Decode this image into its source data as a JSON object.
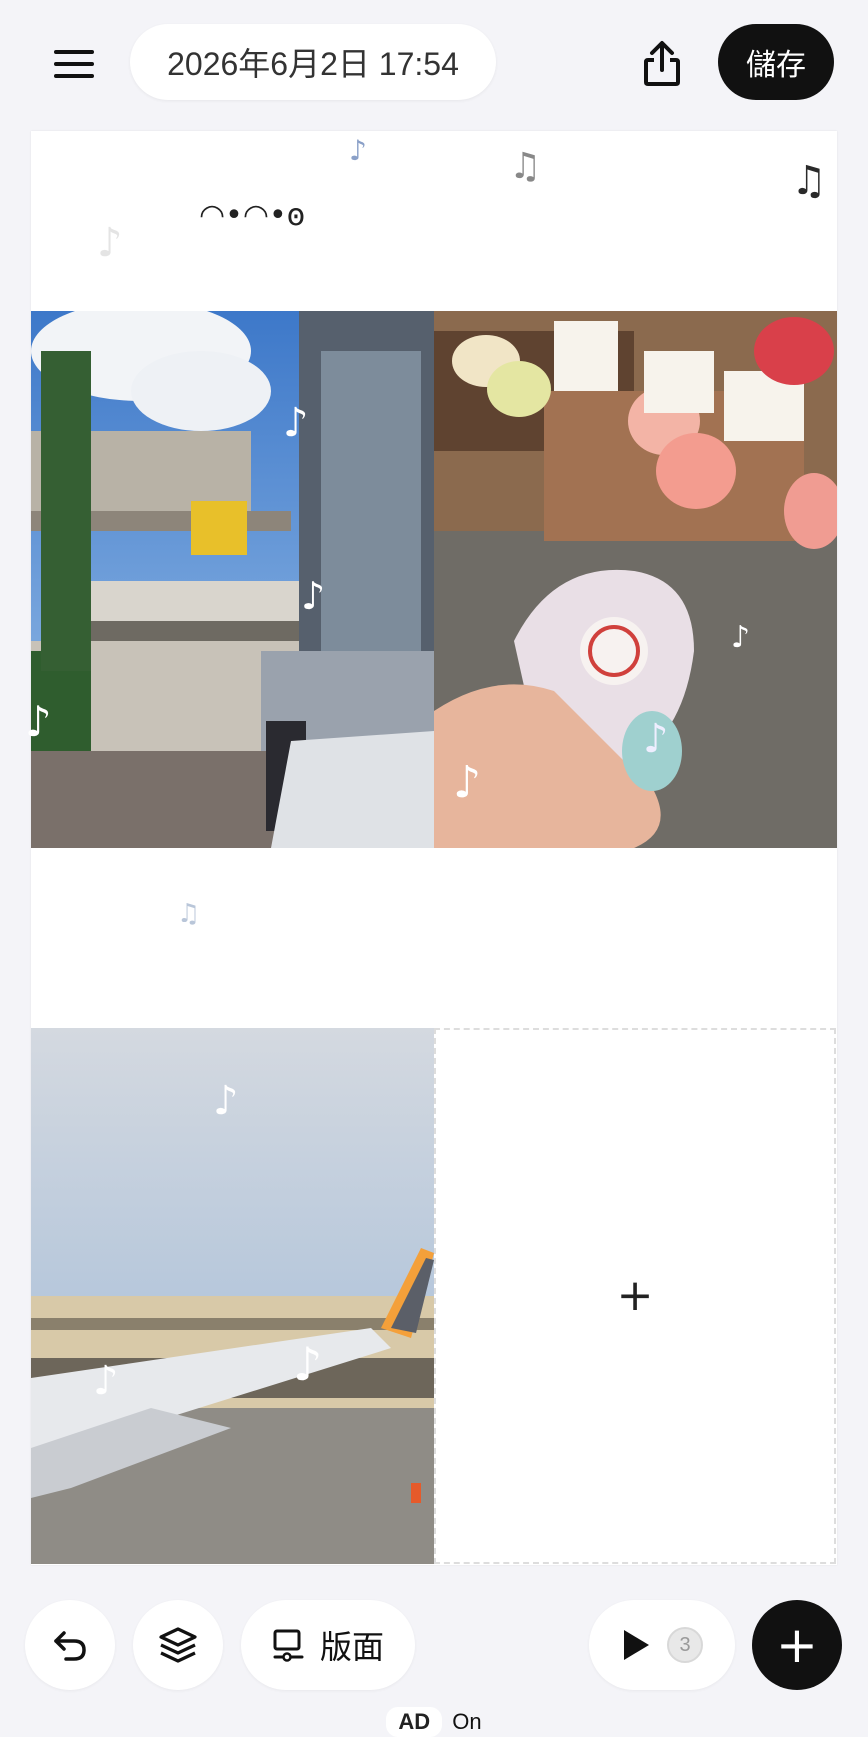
{
  "header": {
    "date_time": "2026年6月2日 17:54",
    "save_label": "儲存"
  },
  "canvas": {
    "sticker_face": "◠•◠•ꙩ",
    "empty_slot_symbol": "+"
  },
  "photos": [
    {
      "description_icon": "city-street-photo"
    },
    {
      "description_icon": "mochi-photo"
    },
    {
      "description_icon": "airplane-wing-photo"
    }
  ],
  "toolbar": {
    "layout_label": "版面",
    "play_count": "3",
    "add_symbol": "+"
  },
  "footer": {
    "ad_label": "AD",
    "ad_status": "On"
  },
  "colors": {
    "accent": "#111111",
    "background": "#f4f4f8"
  }
}
